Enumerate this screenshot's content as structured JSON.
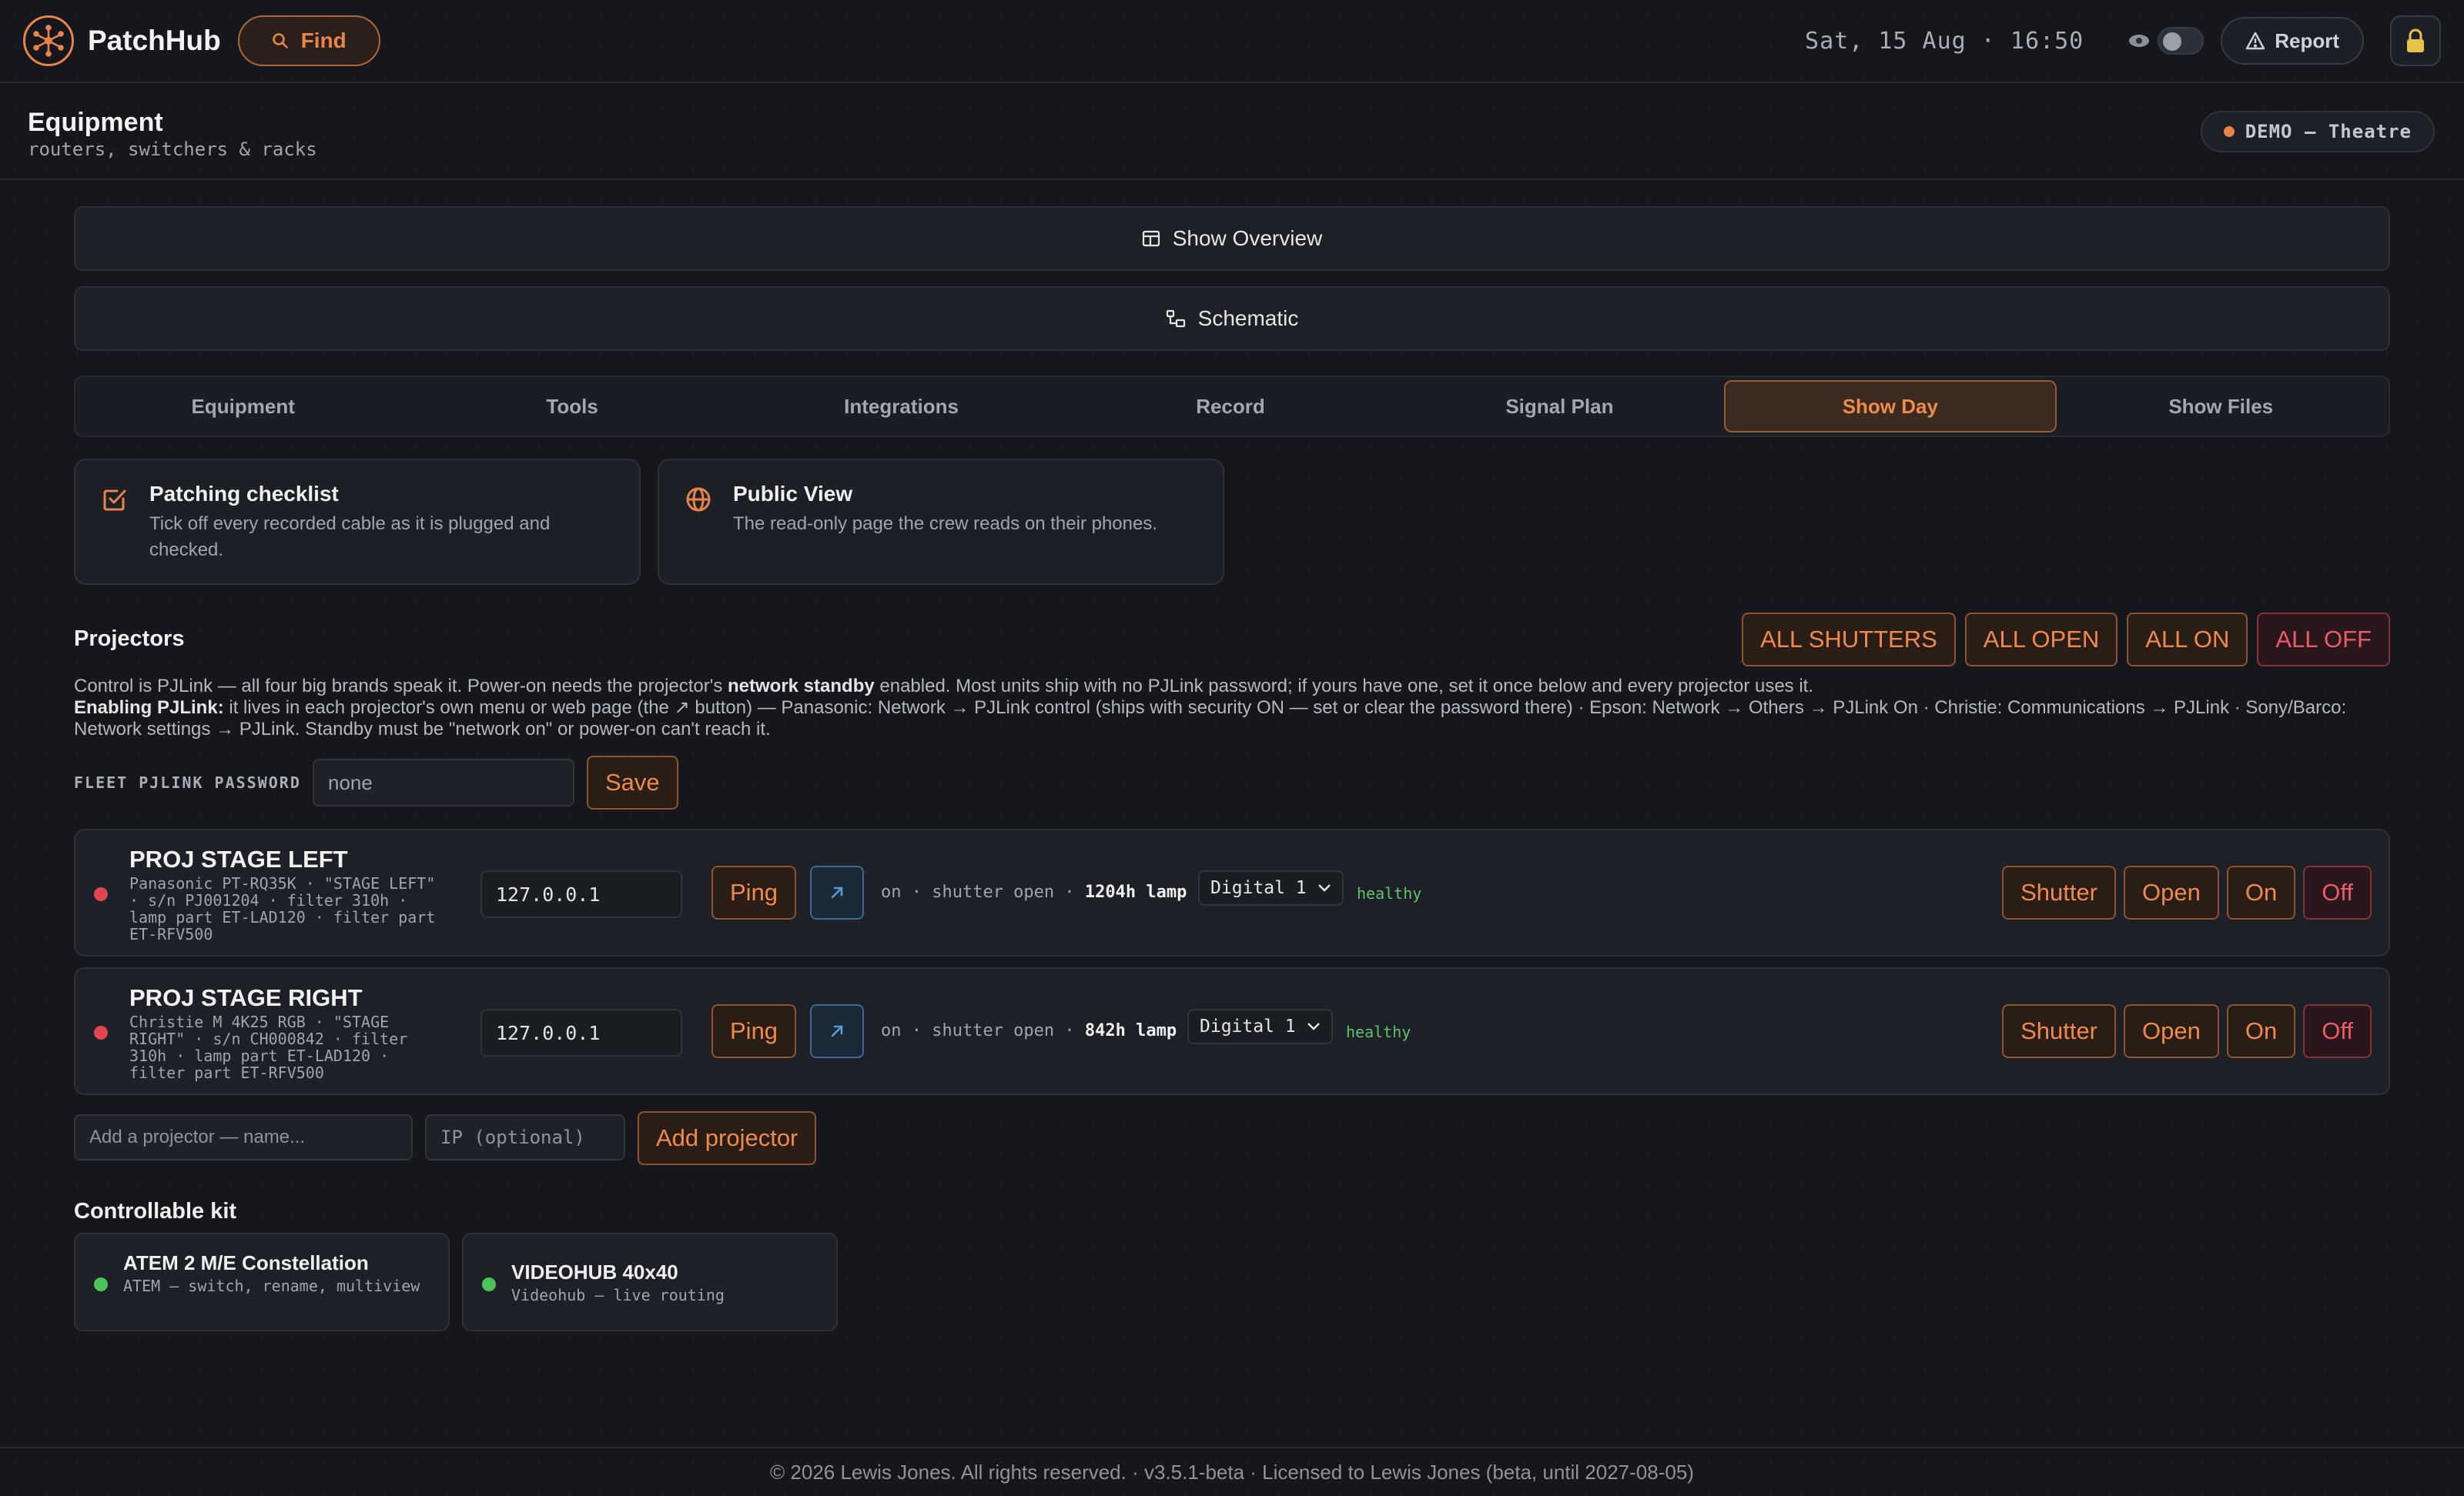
{
  "app": {
    "name": "PatchHub",
    "find_label": "Find"
  },
  "topbar": {
    "clock": "Sat, 15 Aug · 16:50",
    "report_label": "Report"
  },
  "page": {
    "title": "Equipment",
    "subtitle": "routers, switchers & racks",
    "badge": "DEMO — Theatre"
  },
  "nav": {
    "show_overview": "Show Overview",
    "schematic": "Schematic",
    "tabs": [
      {
        "label": "Equipment"
      },
      {
        "label": "Tools"
      },
      {
        "label": "Integrations"
      },
      {
        "label": "Record"
      },
      {
        "label": "Signal Plan"
      },
      {
        "label": "Show Day",
        "active": true
      },
      {
        "label": "Show Files"
      }
    ]
  },
  "cards": [
    {
      "title": "Patching checklist",
      "desc": "Tick off every recorded cable as it is plugged and checked."
    },
    {
      "title": "Public View",
      "desc": "The read-only page the crew reads on their phones."
    }
  ],
  "projectors": {
    "title": "Projectors",
    "all_buttons": [
      "ALL SHUTTERS",
      "ALL OPEN",
      "ALL ON",
      "ALL OFF"
    ],
    "blurb_1a": "Control is PJLink — all four big brands speak it. Power-on needs the projector's ",
    "blurb_1b": "network standby",
    "blurb_1c": " enabled. Most units ship with no PJLink password; if yours have one, set it once below and every projector uses it.",
    "blurb_2a": "Enabling PJLink:",
    "blurb_2b": " it lives in each projector's own menu or web page (the ↗ button) — Panasonic: Network → PJLink control (ships with security ON — set or clear the password there) · Epson: Network → Others → PJLink On · Christie: Communications → PJLink · Sony/Barco: Network settings → PJLink. Standby must be \"network on\" or power-on can't reach it.",
    "password_label": "FLEET PJLINK PASSWORD",
    "password_value": "none",
    "save_label": "Save",
    "items": [
      {
        "name": "PROJ STAGE LEFT",
        "meta": "Panasonic PT-RQ35K · \"STAGE LEFT\" · s/n PJ001204 · filter 310h · lamp part ET-LAD120 · filter part ET-RFV500",
        "ip": "127.0.0.1",
        "state": "on · shutter open · ",
        "lamp": "1204h lamp",
        "input": "Digital 1",
        "health": "healthy"
      },
      {
        "name": "PROJ STAGE RIGHT",
        "meta": "Christie M 4K25 RGB · \"STAGE RIGHT\" · s/n CH000842 · filter 310h · lamp part ET-LAD120 · filter part ET-RFV500",
        "ip": "127.0.0.1",
        "state": "on · shutter open · ",
        "lamp": "842h lamp",
        "input": "Digital 1",
        "health": "healthy"
      }
    ],
    "row_buttons": {
      "ping": "Ping",
      "shutter": "Shutter",
      "open": "Open",
      "on": "On",
      "off": "Off"
    },
    "add_name_placeholder": "Add a projector — name...",
    "add_ip_placeholder": "IP (optional)",
    "add_label": "Add projector"
  },
  "kit": {
    "title": "Controllable kit",
    "items": [
      {
        "name": "ATEM 2 M/E Constellation",
        "desc": "ATEM — switch, rename, multiview"
      },
      {
        "name": "VIDEOHUB 40x40",
        "desc": "Videohub — live routing"
      }
    ]
  },
  "footer": "© 2026 Lewis Jones. All rights reserved. · v3.5.1-beta · Licensed to Lewis Jones (beta, until 2027-08-05)",
  "colors": {
    "accent": "#e8844a",
    "danger": "#ec5a6a",
    "ok": "#4cc35a",
    "link_blue": "#5a9bd5"
  }
}
